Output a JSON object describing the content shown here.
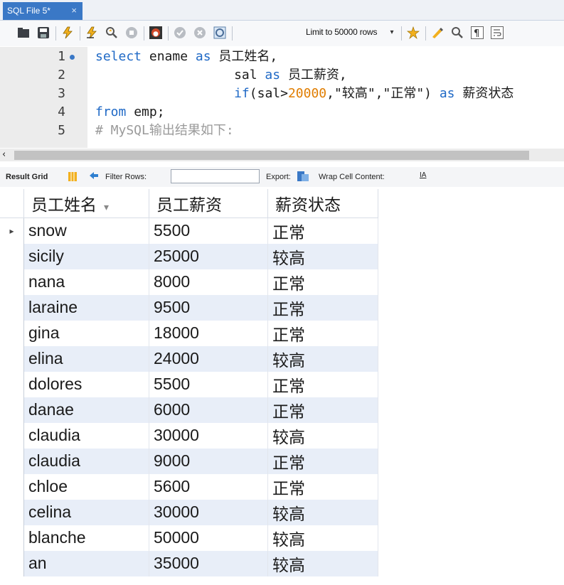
{
  "tab": {
    "title": "SQL File 5*",
    "close_glyph": "×"
  },
  "toolbar": {
    "limit_label": "Limit to 50000 rows",
    "icons": [
      "open-folder-icon",
      "save-icon",
      "execute-icon",
      "execute-current-icon",
      "explain-icon",
      "stop-icon",
      "toggle-continue-icon",
      "commit-icon",
      "rollback-icon",
      "autocommit-icon",
      "bookmark-icon",
      "beautify-icon",
      "find-icon",
      "invisible-chars-icon",
      "wrap-icon"
    ]
  },
  "editor": {
    "line_numbers": [
      "1",
      "2",
      "3",
      "4",
      "5"
    ],
    "lines": [
      [
        {
          "t": "select ",
          "c": "kw"
        },
        {
          "t": "ename ",
          "c": ""
        },
        {
          "t": "as ",
          "c": "kw"
        },
        {
          "t": "员工姓名,",
          "c": ""
        }
      ],
      [
        {
          "t": "                  sal ",
          "c": ""
        },
        {
          "t": "as ",
          "c": "kw"
        },
        {
          "t": "员工薪资,",
          "c": ""
        }
      ],
      [
        {
          "t": "                  ",
          "c": ""
        },
        {
          "t": "if",
          "c": "kw"
        },
        {
          "t": "(sal>",
          "c": ""
        },
        {
          "t": "20000",
          "c": "num"
        },
        {
          "t": ",\"较高\",\"正常\") ",
          "c": ""
        },
        {
          "t": "as ",
          "c": "kw"
        },
        {
          "t": "薪资状态",
          "c": ""
        }
      ],
      [
        {
          "t": "from ",
          "c": "kw"
        },
        {
          "t": "emp;",
          "c": ""
        }
      ],
      [
        {
          "t": "# MySQL输出结果如下:",
          "c": "cmt"
        }
      ]
    ]
  },
  "result_toolbar": {
    "result_grid_label": "Result Grid",
    "filter_label": "Filter Rows:",
    "filter_value": "",
    "export_label": "Export:",
    "wrap_label": "Wrap Cell Content:"
  },
  "grid": {
    "columns": [
      "员工姓名",
      "员工薪资",
      "薪资状态"
    ],
    "rows": [
      [
        "snow",
        "5500",
        "正常"
      ],
      [
        "sicily",
        "25000",
        "较高"
      ],
      [
        "nana",
        "8000",
        "正常"
      ],
      [
        "laraine",
        "9500",
        "正常"
      ],
      [
        "gina",
        "18000",
        "正常"
      ],
      [
        "elina",
        "24000",
        "较高"
      ],
      [
        "dolores",
        "5500",
        "正常"
      ],
      [
        "danae",
        "6000",
        "正常"
      ],
      [
        "claudia",
        "30000",
        "较高"
      ],
      [
        "claudia",
        "9000",
        "正常"
      ],
      [
        "chloe",
        "5600",
        "正常"
      ],
      [
        "celina",
        "30000",
        "较高"
      ],
      [
        "blanche",
        "50000",
        "较高"
      ],
      [
        "an",
        "35000",
        "较高"
      ]
    ],
    "current_row_marker": "▸"
  },
  "colors": {
    "tab_accent": "#3a78c6",
    "keyword": "#1f69c6",
    "number": "#e07d00",
    "comment": "#9a9a9a",
    "row_alt": "#e8eef8"
  }
}
